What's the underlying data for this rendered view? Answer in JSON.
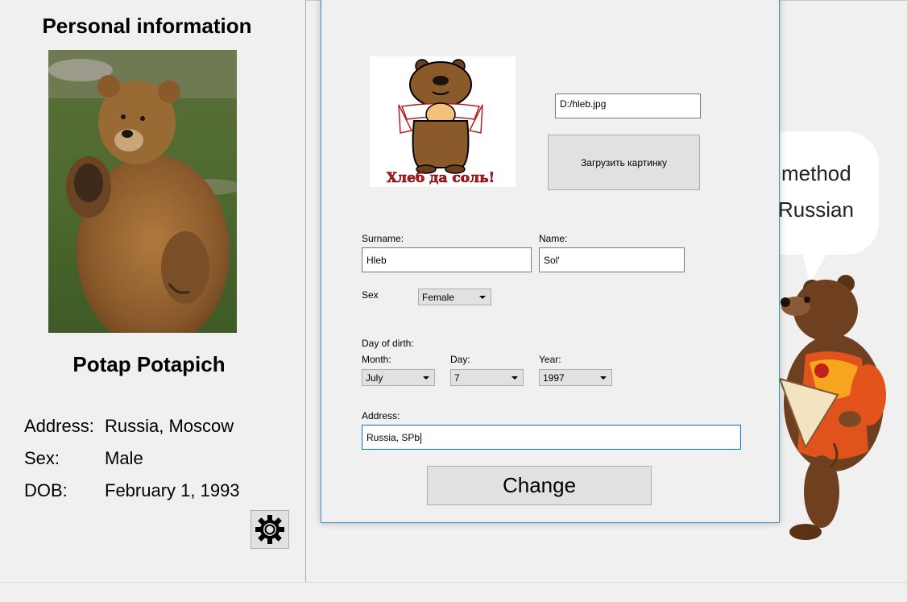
{
  "profile": {
    "title": "Personal information",
    "name": "Potap Potapich",
    "address_label": "Address:",
    "address_value": "Russia, Moscow",
    "sex_label": "Sex:",
    "sex_value": "Male",
    "dob_label": "DOB:",
    "dob_value": "February 1, 1993",
    "settings_icon": "gear-icon"
  },
  "background": {
    "bubble_line1": "method",
    "bubble_line2": "Russian"
  },
  "dialog": {
    "image_caption": "Хлеб да соль!",
    "image_path": "D:/hleb.jpg",
    "load_button": "Загрузить картинку",
    "surname_label": "Surname:",
    "surname_value": "Hleb",
    "name_label": "Name:",
    "name_value": "Sol'",
    "sex_label": "Sex",
    "sex_value": "Female",
    "dob_label": "Day of dirth:",
    "month_label": "Month:",
    "month_value": "July",
    "day_label": "Day:",
    "day_value": "7",
    "year_label": "Year:",
    "year_value": "1997",
    "address_label": "Address:",
    "address_value": "Russia, SPb",
    "change_button": "Change"
  },
  "colors": {
    "window_bg": "#f0f0f0",
    "dialog_border": "#3e8fd1",
    "focus_border": "#0078d7",
    "button_bg": "#e1e1e1"
  }
}
